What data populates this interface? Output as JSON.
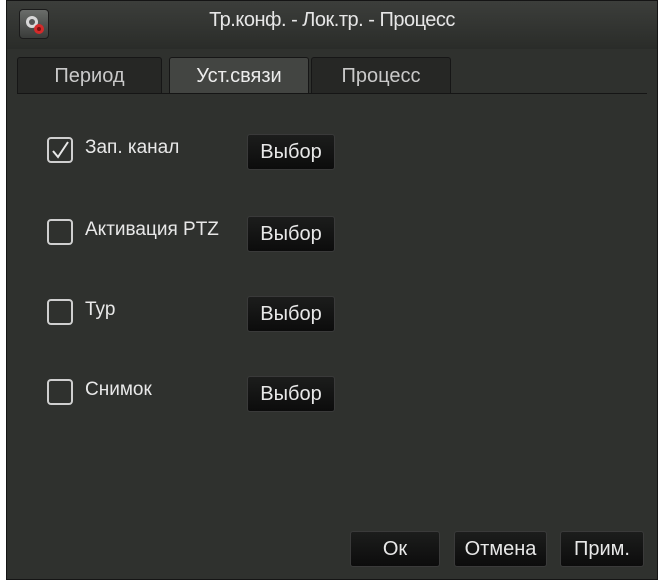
{
  "window": {
    "title": "Тр.конф. - Лок.тр. - Процесс",
    "icon": "camera-settings-icon"
  },
  "tabs": [
    {
      "label": "Период",
      "active": false
    },
    {
      "label": "Уст.связи",
      "active": true
    },
    {
      "label": "Процесс",
      "active": false
    }
  ],
  "options": [
    {
      "label": "Зап. канал",
      "checked": true,
      "button": "Выбор"
    },
    {
      "label": "Активация PTZ",
      "checked": false,
      "button": "Выбор"
    },
    {
      "label": "Тур",
      "checked": false,
      "button": "Выбор"
    },
    {
      "label": "Снимок",
      "checked": false,
      "button": "Выбор"
    }
  ],
  "footer": {
    "ok": "Ок",
    "cancel": "Отмена",
    "apply": "Прим."
  },
  "colors": {
    "background": "#2f312e",
    "text": "#e8e8e8",
    "button": "#111111"
  }
}
